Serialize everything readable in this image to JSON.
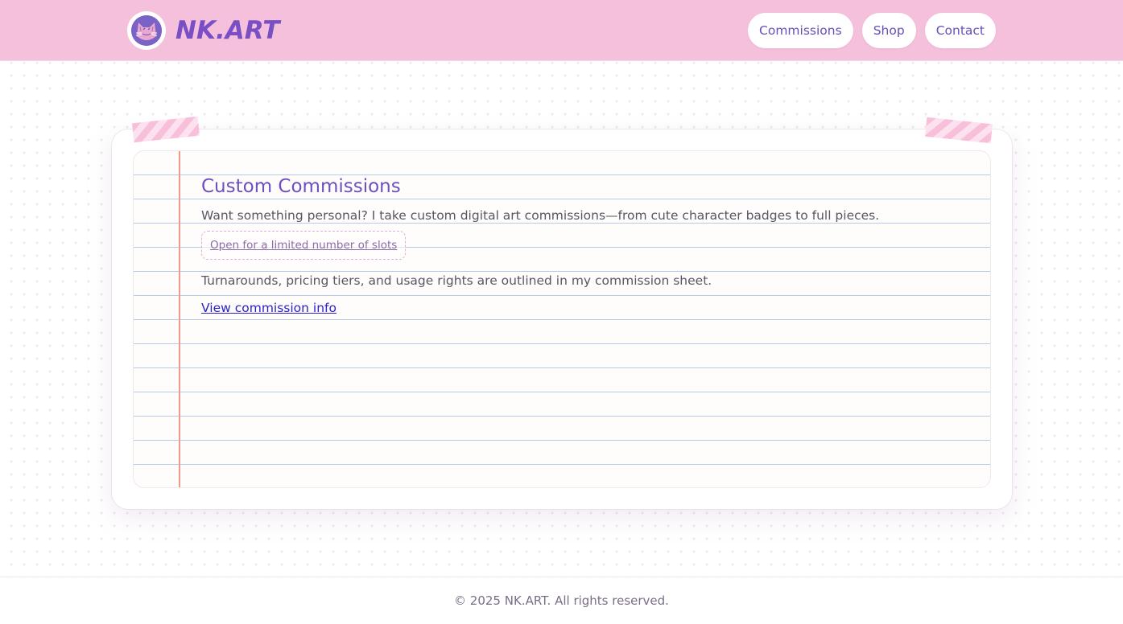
{
  "header": {
    "logo_text": "NK.ART",
    "logo_icon": "cat-avatar-icon",
    "nav": [
      {
        "label": "Commissions"
      },
      {
        "label": "Shop"
      },
      {
        "label": "Contact"
      }
    ]
  },
  "main": {
    "title": "Custom Commissions",
    "intro": "Want something personal? I take custom digital art commissions—from cute character badges to full pieces.",
    "badge": "Open for a limited number of slots",
    "details": "Turnarounds, pricing tiers, and usage rights are outlined in my commission sheet.",
    "link_label": "View commission info"
  },
  "footer": {
    "copyright": "© 2025 NK.ART. All rights reserved."
  },
  "colors": {
    "header_bg": "#f5c0dc",
    "accent": "#6e4fc0",
    "link": "#2b23c9",
    "margin_line": "#f2998e",
    "ruled_line": "#b8cae6"
  }
}
